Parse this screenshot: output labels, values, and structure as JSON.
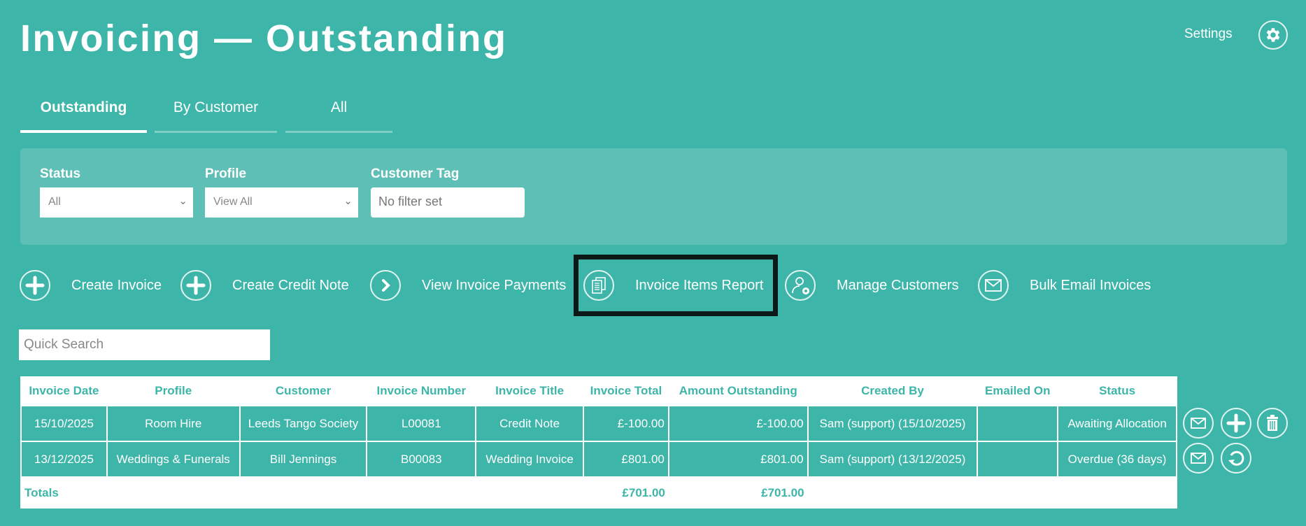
{
  "header": {
    "title": "Invoicing — Outstanding",
    "settings_label": "Settings"
  },
  "tabs": [
    {
      "label": "Outstanding",
      "active": true
    },
    {
      "label": "By Customer"
    },
    {
      "label": "All"
    }
  ],
  "filters": {
    "status": {
      "label": "Status",
      "value": "All"
    },
    "profile": {
      "label": "Profile",
      "value": "View All"
    },
    "customer_tag": {
      "label": "Customer Tag",
      "placeholder": "No filter set"
    }
  },
  "actions": [
    {
      "label": "Create Invoice",
      "icon": "plus-icon"
    },
    {
      "label": "Create Credit Note",
      "icon": "plus-icon"
    },
    {
      "label": "View Invoice Payments",
      "icon": "chevron-right-icon"
    },
    {
      "label": "Invoice Items Report",
      "icon": "documents-icon"
    },
    {
      "label": "Manage Customers",
      "icon": "user-gear-icon"
    },
    {
      "label": "Bulk Email Invoices",
      "icon": "envelope-icon"
    }
  ],
  "search": {
    "placeholder": "Quick Search"
  },
  "table": {
    "headers": [
      "Invoice Date",
      "Profile",
      "Customer",
      "Invoice Number",
      "Invoice Title",
      "Invoice Total",
      "Amount Outstanding",
      "Created By",
      "Emailed On",
      "Status"
    ],
    "rows": [
      [
        "15/10/2025",
        "Room Hire",
        "Leeds Tango Society",
        "L00081",
        "Credit Note",
        "£-100.00",
        "£-100.00",
        "Sam (support) (15/10/2025)",
        "",
        "Awaiting Allocation"
      ],
      [
        "13/12/2025",
        "Weddings & Funerals",
        "Bill Jennings",
        "B00083",
        "Wedding Invoice",
        "£801.00",
        "£801.00",
        "Sam (support) (13/12/2025)",
        "",
        "Overdue (36 days)"
      ]
    ],
    "totals": {
      "label": "Totals",
      "invoice_total": "£701.00",
      "amount_outstanding": "£701.00"
    }
  },
  "colors": {
    "background": "#3db5a9",
    "panel": "#5dbfb5",
    "highlight_border": "#0b1a18"
  }
}
